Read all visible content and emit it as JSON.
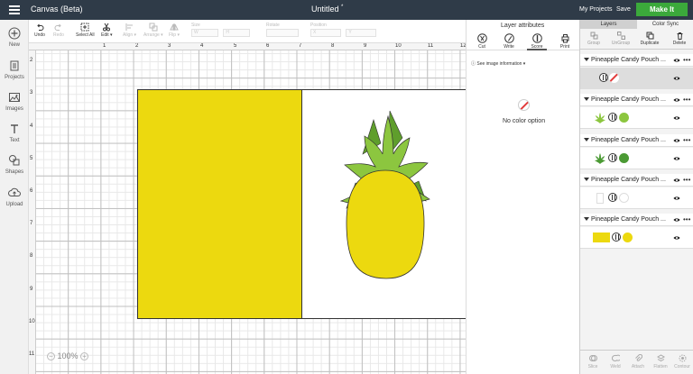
{
  "app": {
    "title": "Canvas (Beta)",
    "document_title": "Untitled",
    "unsaved_mark": "*",
    "my_projects": "My Projects",
    "save": "Save",
    "make_it": "Make It"
  },
  "left_tools": [
    {
      "label": "New",
      "icon": "plus-icon"
    },
    {
      "label": "Projects",
      "icon": "projects-icon"
    },
    {
      "label": "Images",
      "icon": "images-icon"
    },
    {
      "label": "Text",
      "icon": "text-icon"
    },
    {
      "label": "Shapes",
      "icon": "shapes-icon"
    },
    {
      "label": "Upload",
      "icon": "upload-icon"
    }
  ],
  "toolbar": {
    "undo": "Undo",
    "redo": "Redo",
    "select_all": "Select All",
    "edit": "Edit",
    "align": "Align",
    "arrange": "Arrange",
    "flip": "Flip",
    "size_label": "Size",
    "size_w": "W",
    "size_h": "H",
    "rotate_label": "Rotate",
    "position_label": "Position",
    "position_x": "X",
    "position_y": "Y"
  },
  "rulers": {
    "top": [
      "1",
      "2",
      "3",
      "4",
      "5",
      "6",
      "7",
      "8",
      "9",
      "10",
      "11",
      "12"
    ],
    "left": [
      "2",
      "3",
      "4",
      "5",
      "6",
      "7",
      "8",
      "9",
      "10",
      "11"
    ]
  },
  "canvas": {
    "zoom_level": "100%",
    "zoom_minus": "−",
    "zoom_plus": "+",
    "colors": {
      "rectangle": "#ecd90f",
      "pineapple_body": "#ecd90f",
      "leaves_light": "#8cc63f",
      "leaves_dark": "#5f9e2c"
    }
  },
  "attributes": {
    "title": "Layer attributes",
    "tabs": [
      {
        "label": "Cut",
        "icon": "cut-icon"
      },
      {
        "label": "Write",
        "icon": "write-icon"
      },
      {
        "label": "Score",
        "icon": "score-icon"
      },
      {
        "label": "Print",
        "icon": "print-icon"
      }
    ],
    "active_tab": "Score",
    "see_info": "See image information",
    "no_color": "No color option"
  },
  "layers_panel": {
    "tabs": [
      "Layers",
      "Color Sync"
    ],
    "tools": [
      "Group",
      "UnGroup",
      "Duplicate",
      "Delete"
    ],
    "bottom_tools": [
      "Slice",
      "Weld",
      "Attach",
      "Flatten",
      "Contour"
    ],
    "groups": [
      {
        "name": "Pineapple Candy Pouch ...",
        "layer_color": "none",
        "selected": true
      },
      {
        "name": "Pineapple Candy Pouch ...",
        "layer_color": "#8cc63f",
        "selected": false
      },
      {
        "name": "Pineapple Candy Pouch ...",
        "layer_color": "#4b9a34",
        "selected": false
      },
      {
        "name": "Pineapple Candy Pouch ...",
        "layer_color": "#ffffff",
        "selected": false
      },
      {
        "name": "Pineapple Candy Pouch ...",
        "layer_color": "#ecd90f",
        "selected": false
      }
    ]
  }
}
